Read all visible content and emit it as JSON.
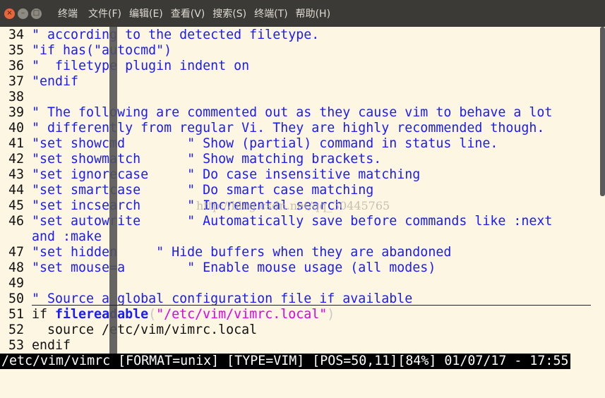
{
  "window": {
    "title": "终端",
    "menu": [
      "文件(F)",
      "编辑(E)",
      "查看(V)",
      "搜索(S)",
      "终端(T)",
      "帮助(H)"
    ],
    "buttons": {
      "close": "×",
      "minimize": "–",
      "maximize": "□"
    }
  },
  "editor": {
    "lines": [
      {
        "num": "34",
        "text": "\" according to the detected filetype."
      },
      {
        "num": "35",
        "text": "\"if has(\"autocmd\")"
      },
      {
        "num": "36",
        "text": "\"  filetype plugin indent on"
      },
      {
        "num": "37",
        "text": "\"endif"
      },
      {
        "num": "38",
        "text": ""
      },
      {
        "num": "39",
        "text": "\" The following are commented out as they cause vim to behave a lot"
      },
      {
        "num": "40",
        "text": "\" differently from regular Vi. They are highly recommended though."
      },
      {
        "num": "41",
        "text": "\"set showcmd        \" Show (partial) command in status line."
      },
      {
        "num": "42",
        "text": "\"set showmatch      \" Show matching brackets."
      },
      {
        "num": "43",
        "text": "\"set ignorecase     \" Do case insensitive matching"
      },
      {
        "num": "44",
        "text": "\"set smartcase      \" Do smart case matching"
      },
      {
        "num": "45",
        "text": "\"set incsearch      \" Incremental search"
      },
      {
        "num": "46",
        "text": "\"set autowrite      \" Automatically save before commands like :next"
      },
      {
        "num": "",
        "text": "and :make"
      },
      {
        "num": "47",
        "text": "\"set hidden     \" Hide buffers when they are abandoned"
      },
      {
        "num": "48",
        "text": "\"set mouse=a        \" Enable mouse usage (all modes)"
      },
      {
        "num": "49",
        "text": ""
      },
      {
        "num": "50",
        "text": "\" Source a global configuration file if available"
      }
    ],
    "code_lines": [
      {
        "num": "51",
        "if": "if ",
        "fn": "filereadable",
        "open": "(",
        "str": "\"/etc/vim/vimrc.local\"",
        "close": ")"
      },
      {
        "num": "52",
        "text": "  source /etc/vim/vimrc.local"
      },
      {
        "num": "53",
        "text": "endif"
      }
    ],
    "status": "/etc/vim/vimrc [FORMAT=unix] [TYPE=VIM] [POS=50,11][84%] 01/07/17 - 17:55",
    "watermark": "http://blog.csdn.net/qq_30445765"
  }
}
